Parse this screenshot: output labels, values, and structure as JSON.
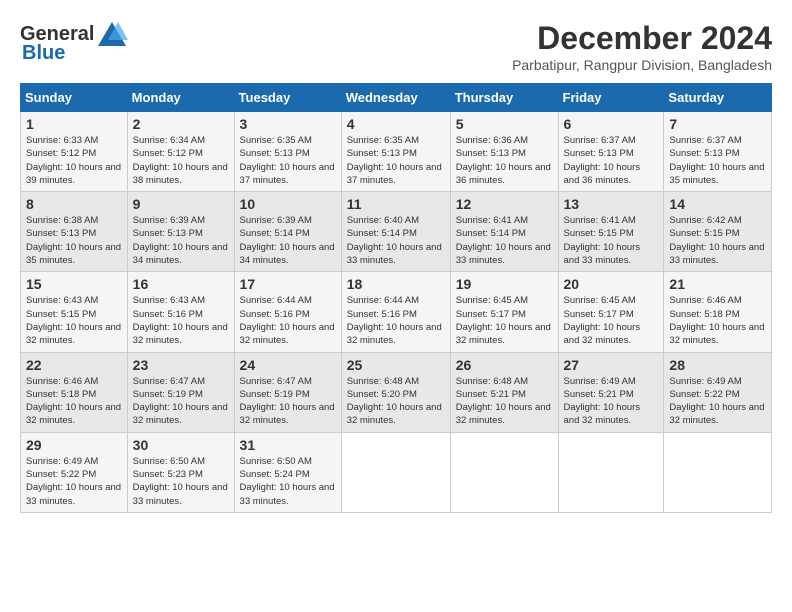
{
  "header": {
    "logo_general": "General",
    "logo_blue": "Blue",
    "month_title": "December 2024",
    "location": "Parbatipur, Rangpur Division, Bangladesh"
  },
  "weekdays": [
    "Sunday",
    "Monday",
    "Tuesday",
    "Wednesday",
    "Thursday",
    "Friday",
    "Saturday"
  ],
  "weeks": [
    [
      {
        "day": "1",
        "sunrise": "6:33 AM",
        "sunset": "5:12 PM",
        "daylight": "10 hours and 39 minutes."
      },
      {
        "day": "2",
        "sunrise": "6:34 AM",
        "sunset": "5:12 PM",
        "daylight": "10 hours and 38 minutes."
      },
      {
        "day": "3",
        "sunrise": "6:35 AM",
        "sunset": "5:13 PM",
        "daylight": "10 hours and 37 minutes."
      },
      {
        "day": "4",
        "sunrise": "6:35 AM",
        "sunset": "5:13 PM",
        "daylight": "10 hours and 37 minutes."
      },
      {
        "day": "5",
        "sunrise": "6:36 AM",
        "sunset": "5:13 PM",
        "daylight": "10 hours and 36 minutes."
      },
      {
        "day": "6",
        "sunrise": "6:37 AM",
        "sunset": "5:13 PM",
        "daylight": "10 hours and 36 minutes."
      },
      {
        "day": "7",
        "sunrise": "6:37 AM",
        "sunset": "5:13 PM",
        "daylight": "10 hours and 35 minutes."
      }
    ],
    [
      {
        "day": "8",
        "sunrise": "6:38 AM",
        "sunset": "5:13 PM",
        "daylight": "10 hours and 35 minutes."
      },
      {
        "day": "9",
        "sunrise": "6:39 AM",
        "sunset": "5:13 PM",
        "daylight": "10 hours and 34 minutes."
      },
      {
        "day": "10",
        "sunrise": "6:39 AM",
        "sunset": "5:14 PM",
        "daylight": "10 hours and 34 minutes."
      },
      {
        "day": "11",
        "sunrise": "6:40 AM",
        "sunset": "5:14 PM",
        "daylight": "10 hours and 33 minutes."
      },
      {
        "day": "12",
        "sunrise": "6:41 AM",
        "sunset": "5:14 PM",
        "daylight": "10 hours and 33 minutes."
      },
      {
        "day": "13",
        "sunrise": "6:41 AM",
        "sunset": "5:15 PM",
        "daylight": "10 hours and 33 minutes."
      },
      {
        "day": "14",
        "sunrise": "6:42 AM",
        "sunset": "5:15 PM",
        "daylight": "10 hours and 33 minutes."
      }
    ],
    [
      {
        "day": "15",
        "sunrise": "6:43 AM",
        "sunset": "5:15 PM",
        "daylight": "10 hours and 32 minutes."
      },
      {
        "day": "16",
        "sunrise": "6:43 AM",
        "sunset": "5:16 PM",
        "daylight": "10 hours and 32 minutes."
      },
      {
        "day": "17",
        "sunrise": "6:44 AM",
        "sunset": "5:16 PM",
        "daylight": "10 hours and 32 minutes."
      },
      {
        "day": "18",
        "sunrise": "6:44 AM",
        "sunset": "5:16 PM",
        "daylight": "10 hours and 32 minutes."
      },
      {
        "day": "19",
        "sunrise": "6:45 AM",
        "sunset": "5:17 PM",
        "daylight": "10 hours and 32 minutes."
      },
      {
        "day": "20",
        "sunrise": "6:45 AM",
        "sunset": "5:17 PM",
        "daylight": "10 hours and 32 minutes."
      },
      {
        "day": "21",
        "sunrise": "6:46 AM",
        "sunset": "5:18 PM",
        "daylight": "10 hours and 32 minutes."
      }
    ],
    [
      {
        "day": "22",
        "sunrise": "6:46 AM",
        "sunset": "5:18 PM",
        "daylight": "10 hours and 32 minutes."
      },
      {
        "day": "23",
        "sunrise": "6:47 AM",
        "sunset": "5:19 PM",
        "daylight": "10 hours and 32 minutes."
      },
      {
        "day": "24",
        "sunrise": "6:47 AM",
        "sunset": "5:19 PM",
        "daylight": "10 hours and 32 minutes."
      },
      {
        "day": "25",
        "sunrise": "6:48 AM",
        "sunset": "5:20 PM",
        "daylight": "10 hours and 32 minutes."
      },
      {
        "day": "26",
        "sunrise": "6:48 AM",
        "sunset": "5:21 PM",
        "daylight": "10 hours and 32 minutes."
      },
      {
        "day": "27",
        "sunrise": "6:49 AM",
        "sunset": "5:21 PM",
        "daylight": "10 hours and 32 minutes."
      },
      {
        "day": "28",
        "sunrise": "6:49 AM",
        "sunset": "5:22 PM",
        "daylight": "10 hours and 32 minutes."
      }
    ],
    [
      {
        "day": "29",
        "sunrise": "6:49 AM",
        "sunset": "5:22 PM",
        "daylight": "10 hours and 33 minutes."
      },
      {
        "day": "30",
        "sunrise": "6:50 AM",
        "sunset": "5:23 PM",
        "daylight": "10 hours and 33 minutes."
      },
      {
        "day": "31",
        "sunrise": "6:50 AM",
        "sunset": "5:24 PM",
        "daylight": "10 hours and 33 minutes."
      },
      null,
      null,
      null,
      null
    ]
  ],
  "labels": {
    "sunrise": "Sunrise:",
    "sunset": "Sunset:",
    "daylight": "Daylight:"
  }
}
